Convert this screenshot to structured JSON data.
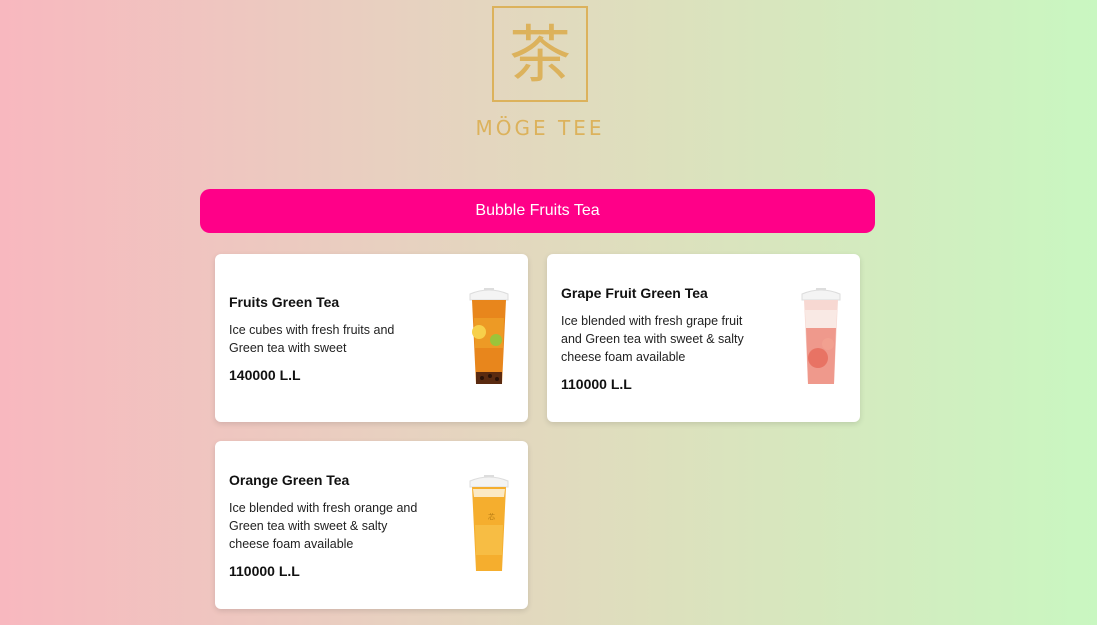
{
  "brand": {
    "logo_glyph": "茶",
    "name": "MÖGE TEE",
    "color": "#dcb25c"
  },
  "category": {
    "label": "Bubble Fruits Tea",
    "color": "#ff0088"
  },
  "products": [
    {
      "title": "Fruits Green Tea",
      "description": "Ice cubes with fresh fruits and Green tea with sweet",
      "price": "140000 L.L",
      "image_icon": "fruit-tea-cup-icon"
    },
    {
      "title": "Grape Fruit Green Tea",
      "description": "Ice blended with fresh grape fruit and Green tea with sweet & salty cheese foam available",
      "price": "110000 L.L",
      "image_icon": "grapefruit-tea-cup-icon"
    },
    {
      "title": "Orange Green Tea",
      "description": "Ice blended with fresh orange and Green tea with sweet & salty cheese foam available",
      "price": "110000 L.L",
      "image_icon": "orange-tea-cup-icon"
    }
  ]
}
